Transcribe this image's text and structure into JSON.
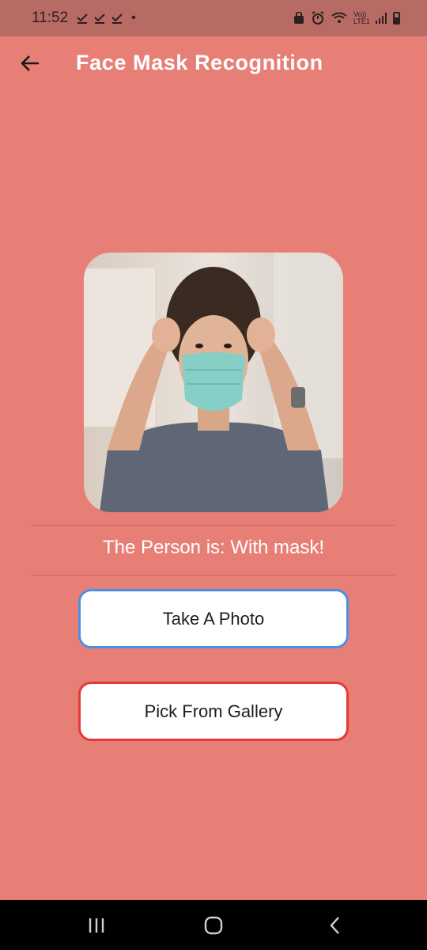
{
  "status_bar": {
    "time": "11:52",
    "checks": "✓ ✓ ✓",
    "dot": "•",
    "lte": "Vo)) LTE1"
  },
  "app_bar": {
    "title": "Face Mask Recognition"
  },
  "result": {
    "text": "The Person is: With mask!"
  },
  "buttons": {
    "take_photo": "Take A Photo",
    "pick_gallery": "Pick From Gallery"
  },
  "colors": {
    "background": "#E77F77",
    "status_bar": "#B86A64",
    "take_photo_border": "#4A90E2",
    "pick_gallery_border": "#E53935"
  }
}
